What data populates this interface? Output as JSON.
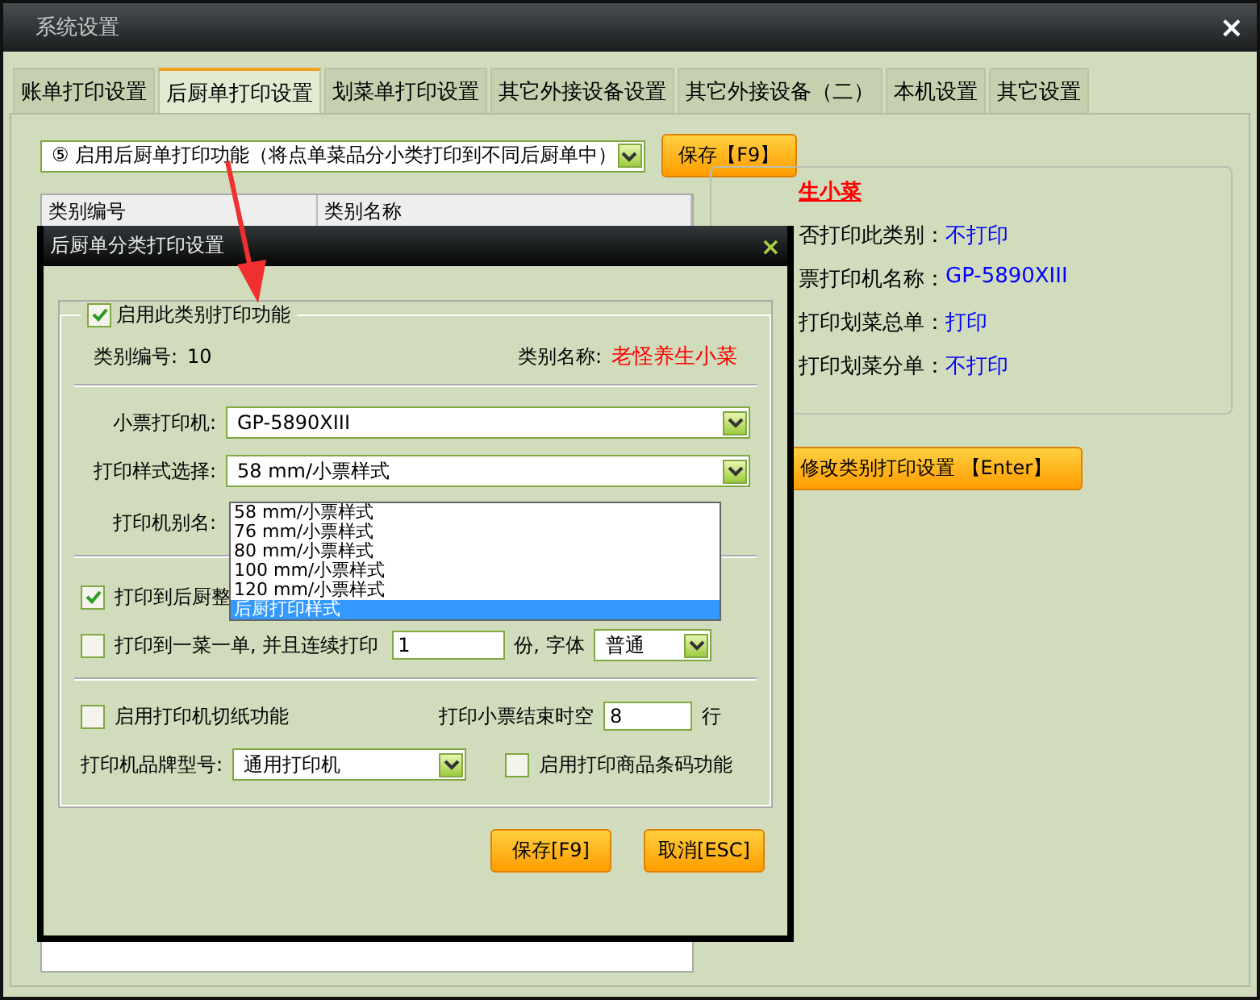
{
  "window": {
    "title": "系统设置",
    "close": "×"
  },
  "tabs": [
    {
      "label": "账单打印设置",
      "selected": false
    },
    {
      "label": "后厨单打印设置",
      "selected": true
    },
    {
      "label": "划菜单打印设置",
      "selected": false
    },
    {
      "label": "其它外接设备设置",
      "selected": false
    },
    {
      "label": "其它外接设备（二）",
      "selected": false
    },
    {
      "label": "本机设置",
      "selected": false
    },
    {
      "label": "其它设置",
      "selected": false
    }
  ],
  "mode_select": {
    "value": "⑤ 启用后厨单打印功能（将点单菜品分小类打印到不同后厨单中）"
  },
  "save_button": "保存【F9】",
  "table": {
    "columns": [
      "类别编号",
      "类别名称"
    ]
  },
  "detail": {
    "title": "生小菜",
    "rows": [
      {
        "label": "否打印此类别：",
        "value": "不打印"
      },
      {
        "label": "票打印机名称：",
        "value": "GP-5890XIII"
      },
      {
        "label": "打印划菜总单：",
        "value": "打印"
      },
      {
        "label": "打印划菜分单：",
        "value": "不打印"
      }
    ],
    "button": "修改类别打印设置 【Enter】"
  },
  "dialog": {
    "title": "后厨单分类打印设置",
    "close": "×",
    "enable": {
      "label": "启用此类别打印功能",
      "checked": true
    },
    "code_label": "类别编号:",
    "code": "10",
    "name_label": "类别名称:",
    "name": "老怪养生小菜",
    "printer_label": "小票打印机:",
    "printer": "GP-5890XIII",
    "style_label": "打印样式选择:",
    "style": "58  mm/小票样式",
    "style_options": [
      {
        "label": "58  mm/小票样式",
        "selected": false
      },
      {
        "label": "76  mm/小票样式",
        "selected": false
      },
      {
        "label": "80  mm/小票样式",
        "selected": false
      },
      {
        "label": "100 mm/小票样式",
        "selected": false
      },
      {
        "label": "120 mm/小票样式",
        "selected": false
      },
      {
        "label": "后厨打印样式",
        "selected": true
      }
    ],
    "alias_label": "打印机别名:",
    "whole": {
      "label": "打印到后厨整",
      "checked": true
    },
    "single": {
      "label": "打印到一菜一单, 并且连续打印",
      "checked": false,
      "copies": "1",
      "copies_label": "份, 字体",
      "font": "普通"
    },
    "cut": {
      "label": "启用打印机切纸功能",
      "checked": false
    },
    "blank_label": "打印小票结束时空",
    "blank": "8",
    "blank_unit": "行",
    "brand_label": "打印机品牌型号:",
    "brand": "通用打印机",
    "barcode": {
      "label": "启用打印商品条码功能",
      "checked": false
    },
    "buttons": [
      "保存[F9]",
      "取消[ESC]"
    ]
  }
}
